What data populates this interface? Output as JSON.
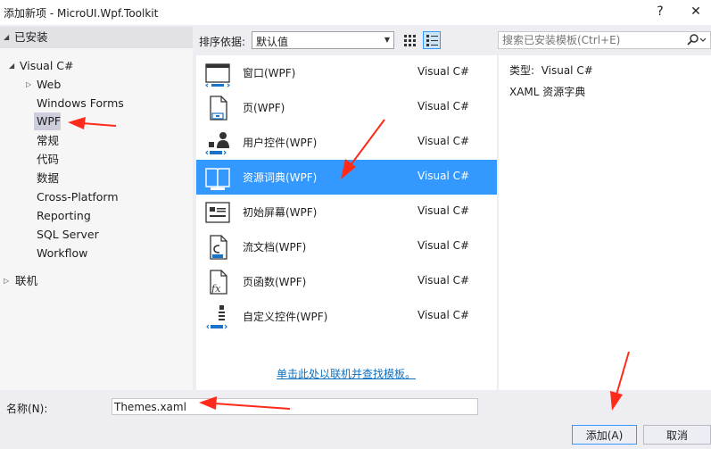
{
  "window": {
    "title": "添加新项 - MicroUI.Wpf.Toolkit",
    "help_glyph": "?",
    "close_glyph": "✕"
  },
  "tree": {
    "header": "已安装",
    "items": [
      {
        "label": "Visual C#",
        "expander": "◢"
      },
      {
        "label": "Web",
        "expander": "▷"
      },
      {
        "label": "Windows Forms"
      },
      {
        "label": "WPF"
      },
      {
        "label": "常规"
      },
      {
        "label": "代码"
      },
      {
        "label": "数据"
      },
      {
        "label": "Cross-Platform"
      },
      {
        "label": "Reporting"
      },
      {
        "label": "SQL Server"
      },
      {
        "label": "Workflow"
      }
    ],
    "online": {
      "label": "联机",
      "expander": "▷"
    },
    "header_expander": "◢"
  },
  "toolbar": {
    "sort_label": "排序依据:",
    "sort_value": "默认值",
    "sort_arrow": "▼",
    "search_placeholder": "搜索已安装模板(Ctrl+E)"
  },
  "templates": [
    {
      "name": "窗口(WPF)",
      "type": "Visual C#",
      "icon": "window-icon"
    },
    {
      "name": "页(WPF)",
      "type": "Visual C#",
      "icon": "page-icon"
    },
    {
      "name": "用户控件(WPF)",
      "type": "Visual C#",
      "icon": "user-control-icon"
    },
    {
      "name": "资源词典(WPF)",
      "type": "Visual C#",
      "icon": "resource-dictionary-icon",
      "selected": true
    },
    {
      "name": "初始屏幕(WPF)",
      "type": "Visual C#",
      "icon": "splash-screen-icon"
    },
    {
      "name": "流文档(WPF)",
      "type": "Visual C#",
      "icon": "flow-document-icon"
    },
    {
      "name": "页函数(WPF)",
      "type": "Visual C#",
      "icon": "page-function-icon"
    },
    {
      "name": "自定义控件(WPF)",
      "type": "Visual C#",
      "icon": "custom-control-icon"
    }
  ],
  "online_link": "单击此处以联机并查找模板。",
  "details": {
    "type_label": "类型:",
    "type_value": "Visual C#",
    "description": "XAML 资源字典"
  },
  "name_field": {
    "label": "名称(N):",
    "value": "Themes.xaml"
  },
  "buttons": {
    "add": "添加(A)",
    "cancel": "取消"
  },
  "colors": {
    "selection": "#3399ff",
    "link": "#0e70c0",
    "annotation": "#ff2a1a"
  }
}
